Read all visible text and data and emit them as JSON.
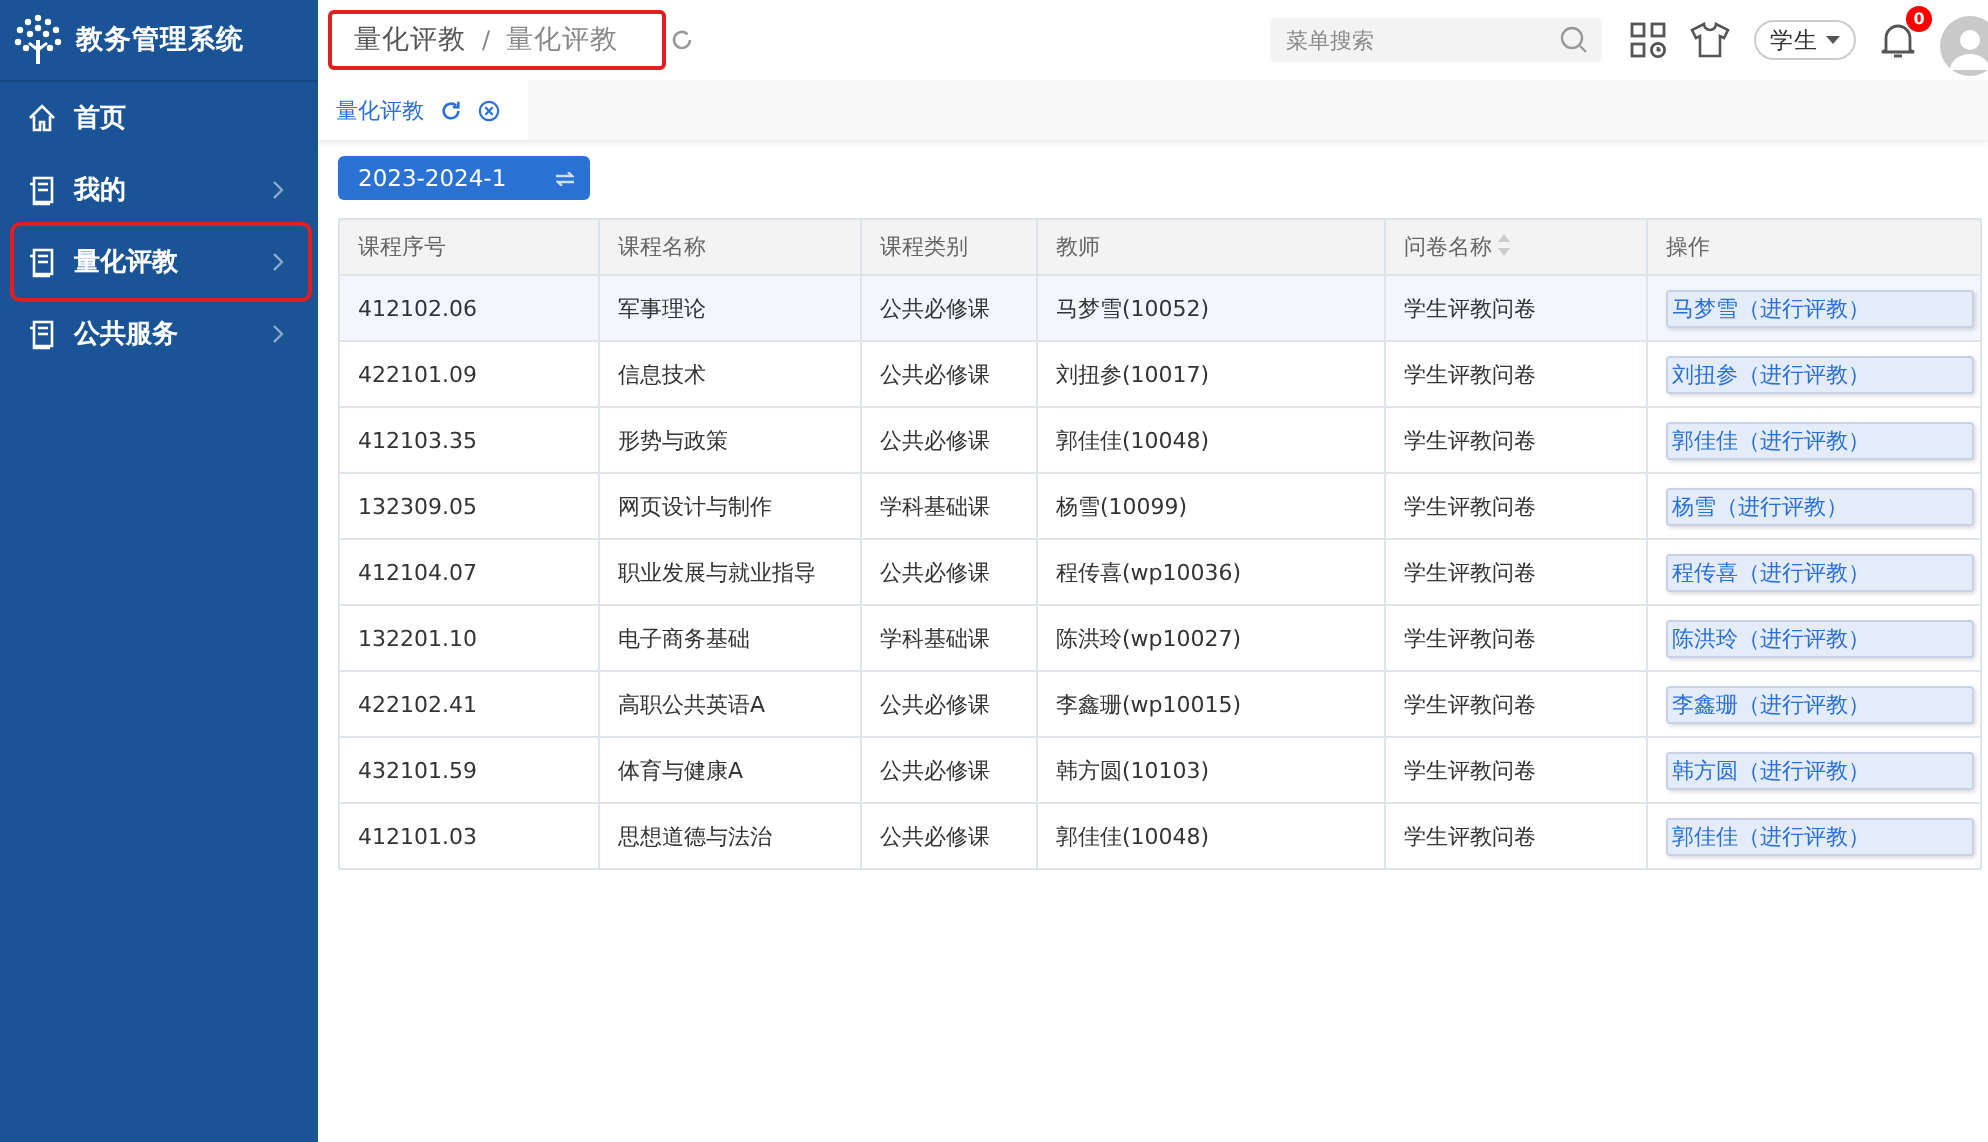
{
  "app": {
    "title": "教务管理系统"
  },
  "sidebar": {
    "items": [
      {
        "label": "首页",
        "kind": "home",
        "has_arrow": false,
        "highlighted": false
      },
      {
        "label": "我的",
        "kind": "doc",
        "has_arrow": true,
        "highlighted": false
      },
      {
        "label": "量化评教",
        "kind": "doc",
        "has_arrow": true,
        "highlighted": true
      },
      {
        "label": "公共服务",
        "kind": "doc",
        "has_arrow": true,
        "highlighted": false
      }
    ]
  },
  "breadcrumb": {
    "items": [
      "量化评教",
      "量化评教"
    ],
    "separator": "/",
    "highlighted": true
  },
  "header": {
    "search": {
      "placeholder": "菜单搜索"
    },
    "role": "学生",
    "notifications": "0"
  },
  "tabs": [
    {
      "label": "量化评教",
      "selected": true
    }
  ],
  "semester": "2023-2024-1",
  "table": {
    "columns": [
      {
        "label": "课程序号",
        "sortable": false
      },
      {
        "label": "课程名称",
        "sortable": false
      },
      {
        "label": "课程类别",
        "sortable": false
      },
      {
        "label": "教师",
        "sortable": false
      },
      {
        "label": "问卷名称",
        "sortable": true
      },
      {
        "label": "操作",
        "sortable": false
      }
    ],
    "rows": [
      {
        "selected": true,
        "cells": [
          "412102.06",
          "军事理论",
          "公共必修课",
          "马梦雪(10052)",
          "学生评教问卷"
        ],
        "action": "马梦雪（进行评教）"
      },
      {
        "selected": false,
        "cells": [
          "422101.09",
          "信息技术",
          "公共必修课",
          "刘扭参(10017)",
          "学生评教问卷"
        ],
        "action": "刘扭参（进行评教）"
      },
      {
        "selected": false,
        "cells": [
          "412103.35",
          "形势与政策",
          "公共必修课",
          "郭佳佳(10048)",
          "学生评教问卷"
        ],
        "action": "郭佳佳（进行评教）"
      },
      {
        "selected": false,
        "cells": [
          "132309.05",
          "网页设计与制作",
          "学科基础课",
          "杨雪(10099)",
          "学生评教问卷"
        ],
        "action": "杨雪（进行评教）"
      },
      {
        "selected": false,
        "cells": [
          "412104.07",
          "职业发展与就业指导",
          "公共必修课",
          "程传喜(wp10036)",
          "学生评教问卷"
        ],
        "action": "程传喜（进行评教）"
      },
      {
        "selected": false,
        "cells": [
          "132201.10",
          "电子商务基础",
          "学科基础课",
          "陈洪玲(wp10027)",
          "学生评教问卷"
        ],
        "action": "陈洪玲（进行评教）"
      },
      {
        "selected": false,
        "cells": [
          "422102.41",
          "高职公共英语A",
          "公共必修课",
          "李鑫珊(wp10015)",
          "学生评教问卷"
        ],
        "action": "李鑫珊（进行评教）"
      },
      {
        "selected": false,
        "cells": [
          "432101.59",
          "体育与健康A",
          "公共必修课",
          "韩方圆(10103)",
          "学生评教问卷"
        ],
        "action": "韩方圆（进行评教）"
      },
      {
        "selected": false,
        "cells": [
          "412101.03",
          "思想道德与法治",
          "公共必修课",
          "郭佳佳(10048)",
          "学生评教问卷"
        ],
        "action": "郭佳佳（进行评教）"
      }
    ]
  }
}
